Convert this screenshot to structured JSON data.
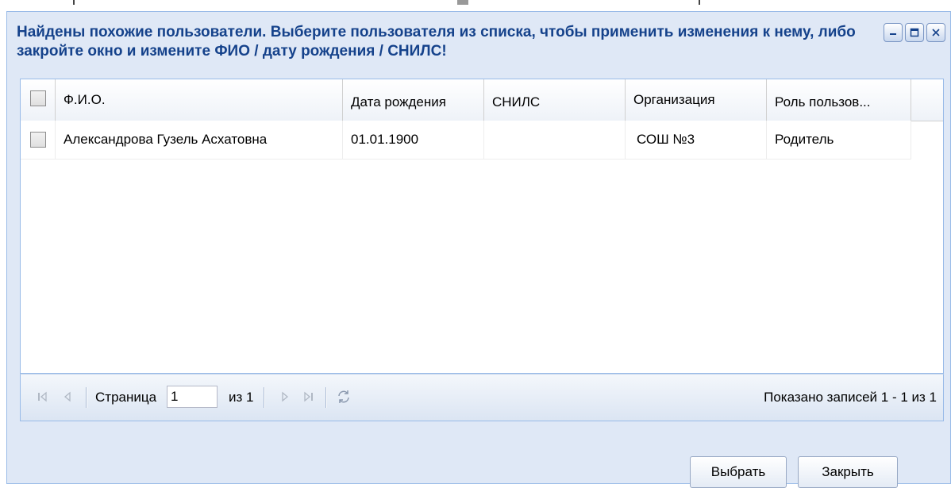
{
  "dialog": {
    "title": "Найдены похожие пользователи. Выберите пользователя из списка, чтобы применить изменения к нему, либо закройте окно и измените ФИО / дату рождения / СНИЛС!",
    "tools": [
      "minimize-icon",
      "maximize-icon",
      "close-icon"
    ]
  },
  "grid": {
    "columns": [
      "Ф.И.О.",
      "Дата рождения",
      "СНИЛС",
      "Организация",
      "Роль пользов..."
    ],
    "rows": [
      {
        "checked": false,
        "fio": "Александрова Гузель Асхатовна",
        "birth_date": "01.01.1900",
        "snils": "",
        "organization": "СОШ №3",
        "role": "Родитель"
      }
    ]
  },
  "pager": {
    "page_label": "Страница",
    "page_value": "1",
    "of_label": "из 1",
    "summary": "Показано записей 1 - 1 из 1",
    "icons": [
      "first-page-icon",
      "prev-page-icon",
      "next-page-icon",
      "last-page-icon",
      "refresh-icon"
    ]
  },
  "buttons": {
    "select": "Выбрать",
    "close": "Закрыть"
  }
}
